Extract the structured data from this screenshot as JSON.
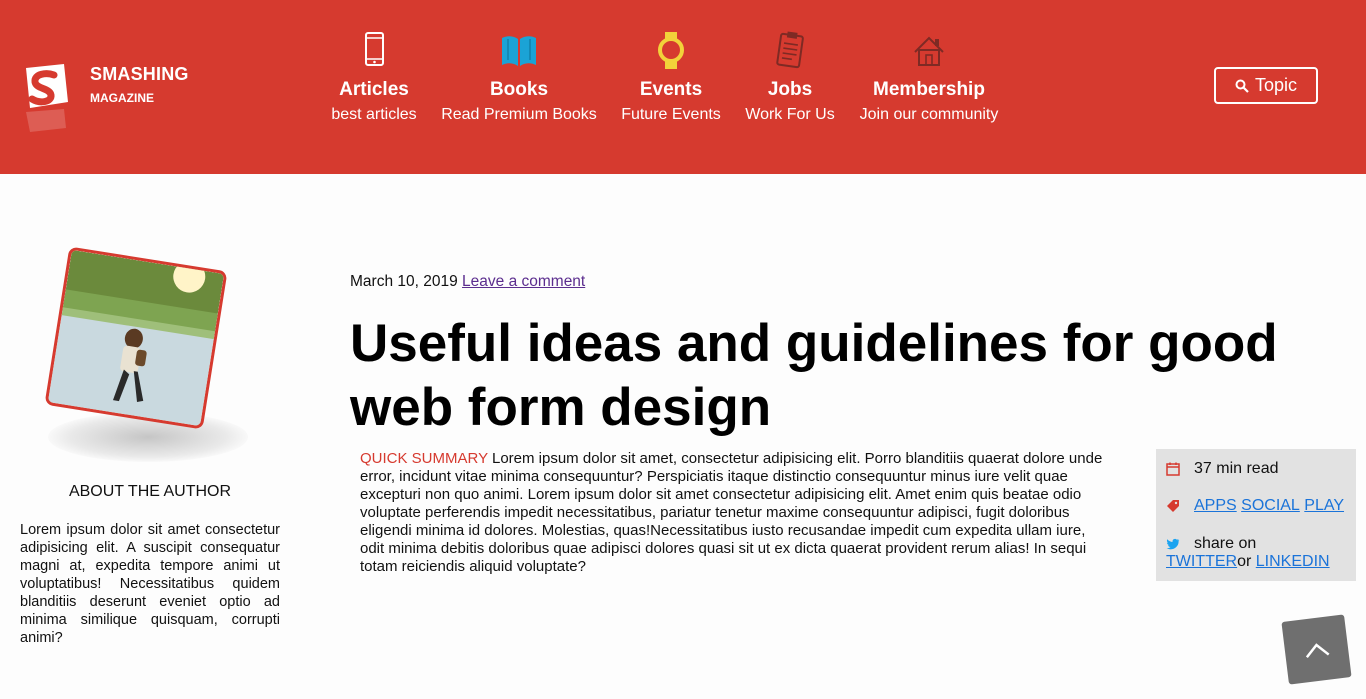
{
  "header": {
    "brand_name": "SMASHING",
    "brand_sub": "MAGAZINE",
    "nav": [
      {
        "title": "Articles",
        "subtitle": "best articles",
        "icon": "phone-icon"
      },
      {
        "title": "Books",
        "subtitle": "Read Premium Books",
        "icon": "book-icon"
      },
      {
        "title": "Events",
        "subtitle": "Future Events",
        "icon": "watch-icon"
      },
      {
        "title": "Jobs",
        "subtitle": "Work For Us",
        "icon": "clipboard-icon"
      },
      {
        "title": "Membership",
        "subtitle": "Join our community",
        "icon": "home-icon"
      }
    ],
    "topic_button": "Topic",
    "colors": {
      "brand": "#d63a2f",
      "book_icon": "#1ba3d6",
      "watch_icon": "#f2d23a"
    }
  },
  "author": {
    "about_title": "ABOUT THE AUTHOR",
    "bio": "Lorem ipsum dolor sit amet consectetur adipisicing elit. A suscipit consequatur magni at, expedita tempore animi ut voluptatibus! Necessitatibus quidem blanditiis deserunt eveniet optio ad minima similique quisquam, corrupti animi?"
  },
  "article": {
    "date": "March 10, 2019",
    "comment_link": "Leave a comment",
    "title": "Useful ideas and guidelines for good web form design",
    "summary_label": "QUICK SUMMARY",
    "summary": "Lorem ipsum dolor sit amet, consectetur adipisicing elit. Porro blanditiis quaerat dolore unde error, incidunt vitae minima consequuntur? Perspiciatis itaque distinctio consequuntur minus iure velit quae excepturi non quo animi. Lorem ipsum dolor sit amet consectetur adipisicing elit. Amet enim quis beatae odio voluptate perferendis impedit necessitatibus, pariatur tenetur maxime consequuntur adipisci, fugit doloribus eligendi minima id dolores. Molestias, quas!Necessitatibus iusto recusandae impedit cum expedita ullam iure, odit minima debitis doloribus quae adipisci dolores quasi sit ut ex dicta quaerat provident rerum alias! In sequi totam reiciendis aliquid voluptate?"
  },
  "info": {
    "read_time": "37 min read",
    "tags": [
      "APPS",
      "SOCIAL",
      "PLAY"
    ],
    "share_label": "share on",
    "share_twitter": "TWITTER",
    "share_or": "or",
    "share_linkedin": "LINKEDIN",
    "link_color": "#1a73d9"
  },
  "scroll_top_icon": "chevron-up-icon"
}
